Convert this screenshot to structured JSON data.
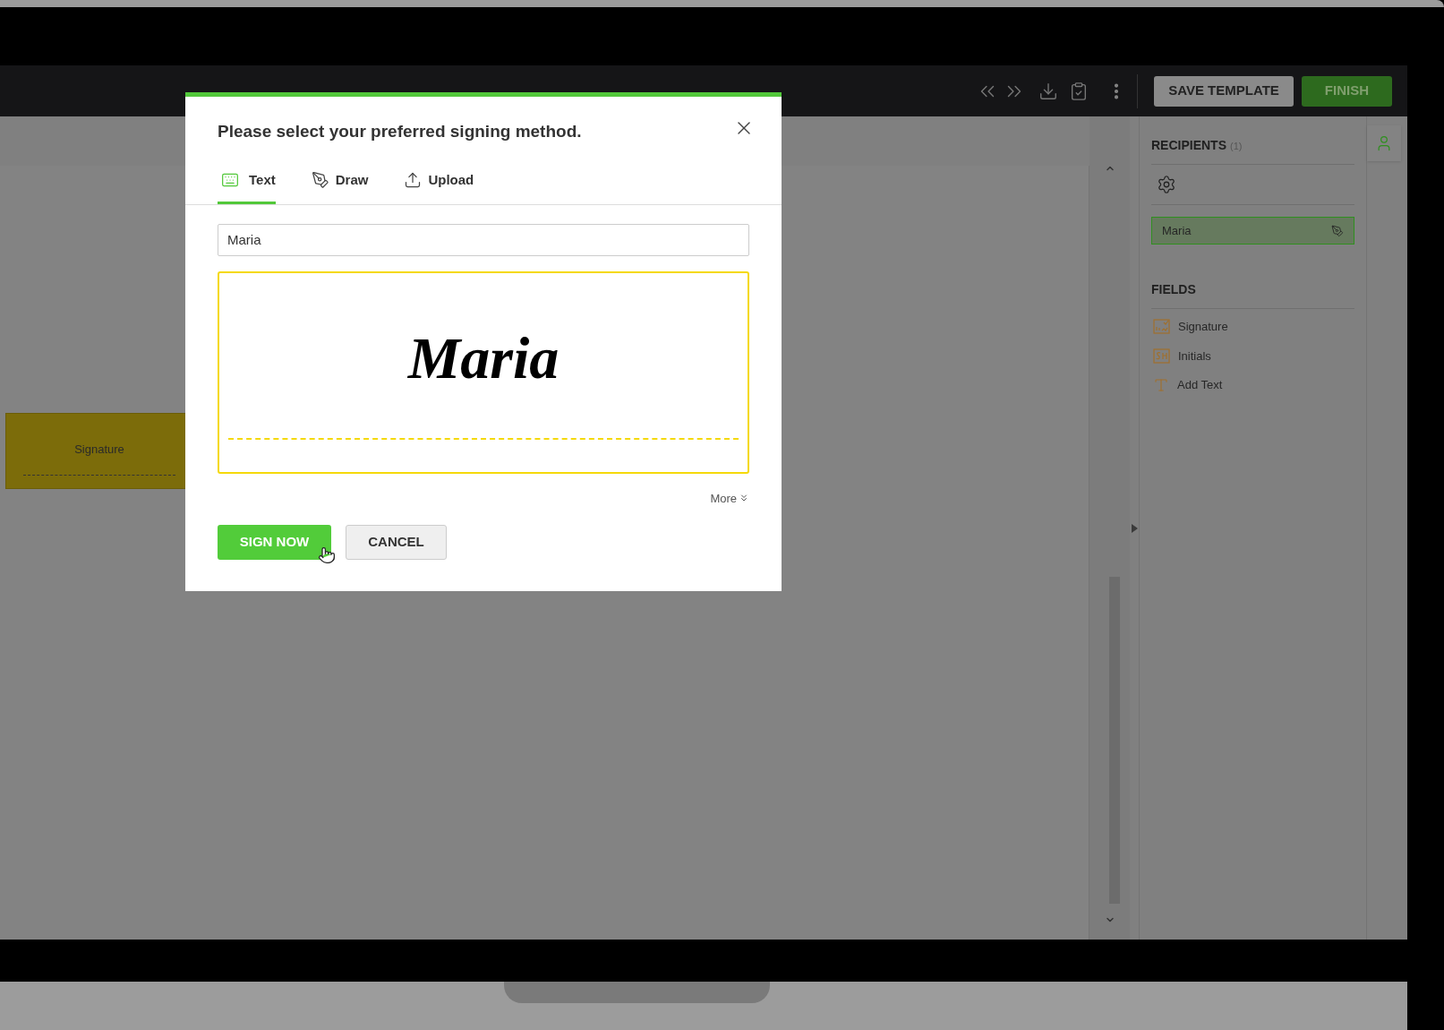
{
  "toolbar": {
    "buttons": [
      {
        "label": "SAVE TEMPLATE",
        "kind": "secondary"
      },
      {
        "label": "FINISH",
        "kind": "primary"
      }
    ]
  },
  "document": {
    "fields": [
      {
        "label": "Signature"
      }
    ]
  },
  "sidebar": {
    "recipients": {
      "title": "RECIPIENTS",
      "count": "(1)",
      "items": [
        {
          "name": "Maria",
          "selected": true
        }
      ]
    },
    "fields": {
      "title": "FIELDS",
      "items": [
        {
          "label": "Signature",
          "kind": "signature"
        },
        {
          "label": "Initials",
          "kind": "initials"
        },
        {
          "label": "Add Text",
          "kind": "text"
        }
      ]
    }
  },
  "dialog": {
    "title": "Please select your preferred signing method.",
    "tabs": [
      {
        "label": "Text",
        "kind": "keyboard",
        "selected": true
      },
      {
        "label": "Draw",
        "kind": "pen",
        "selected": false
      },
      {
        "label": "Upload",
        "kind": "upload",
        "selected": false
      }
    ],
    "name_field": {
      "value": "Maria"
    },
    "signature_preview": "Maria",
    "more_link": "More",
    "buttons": [
      {
        "label": "SIGN NOW",
        "kind": "primary"
      },
      {
        "label": "CANCEL",
        "kind": "secondary"
      }
    ]
  }
}
